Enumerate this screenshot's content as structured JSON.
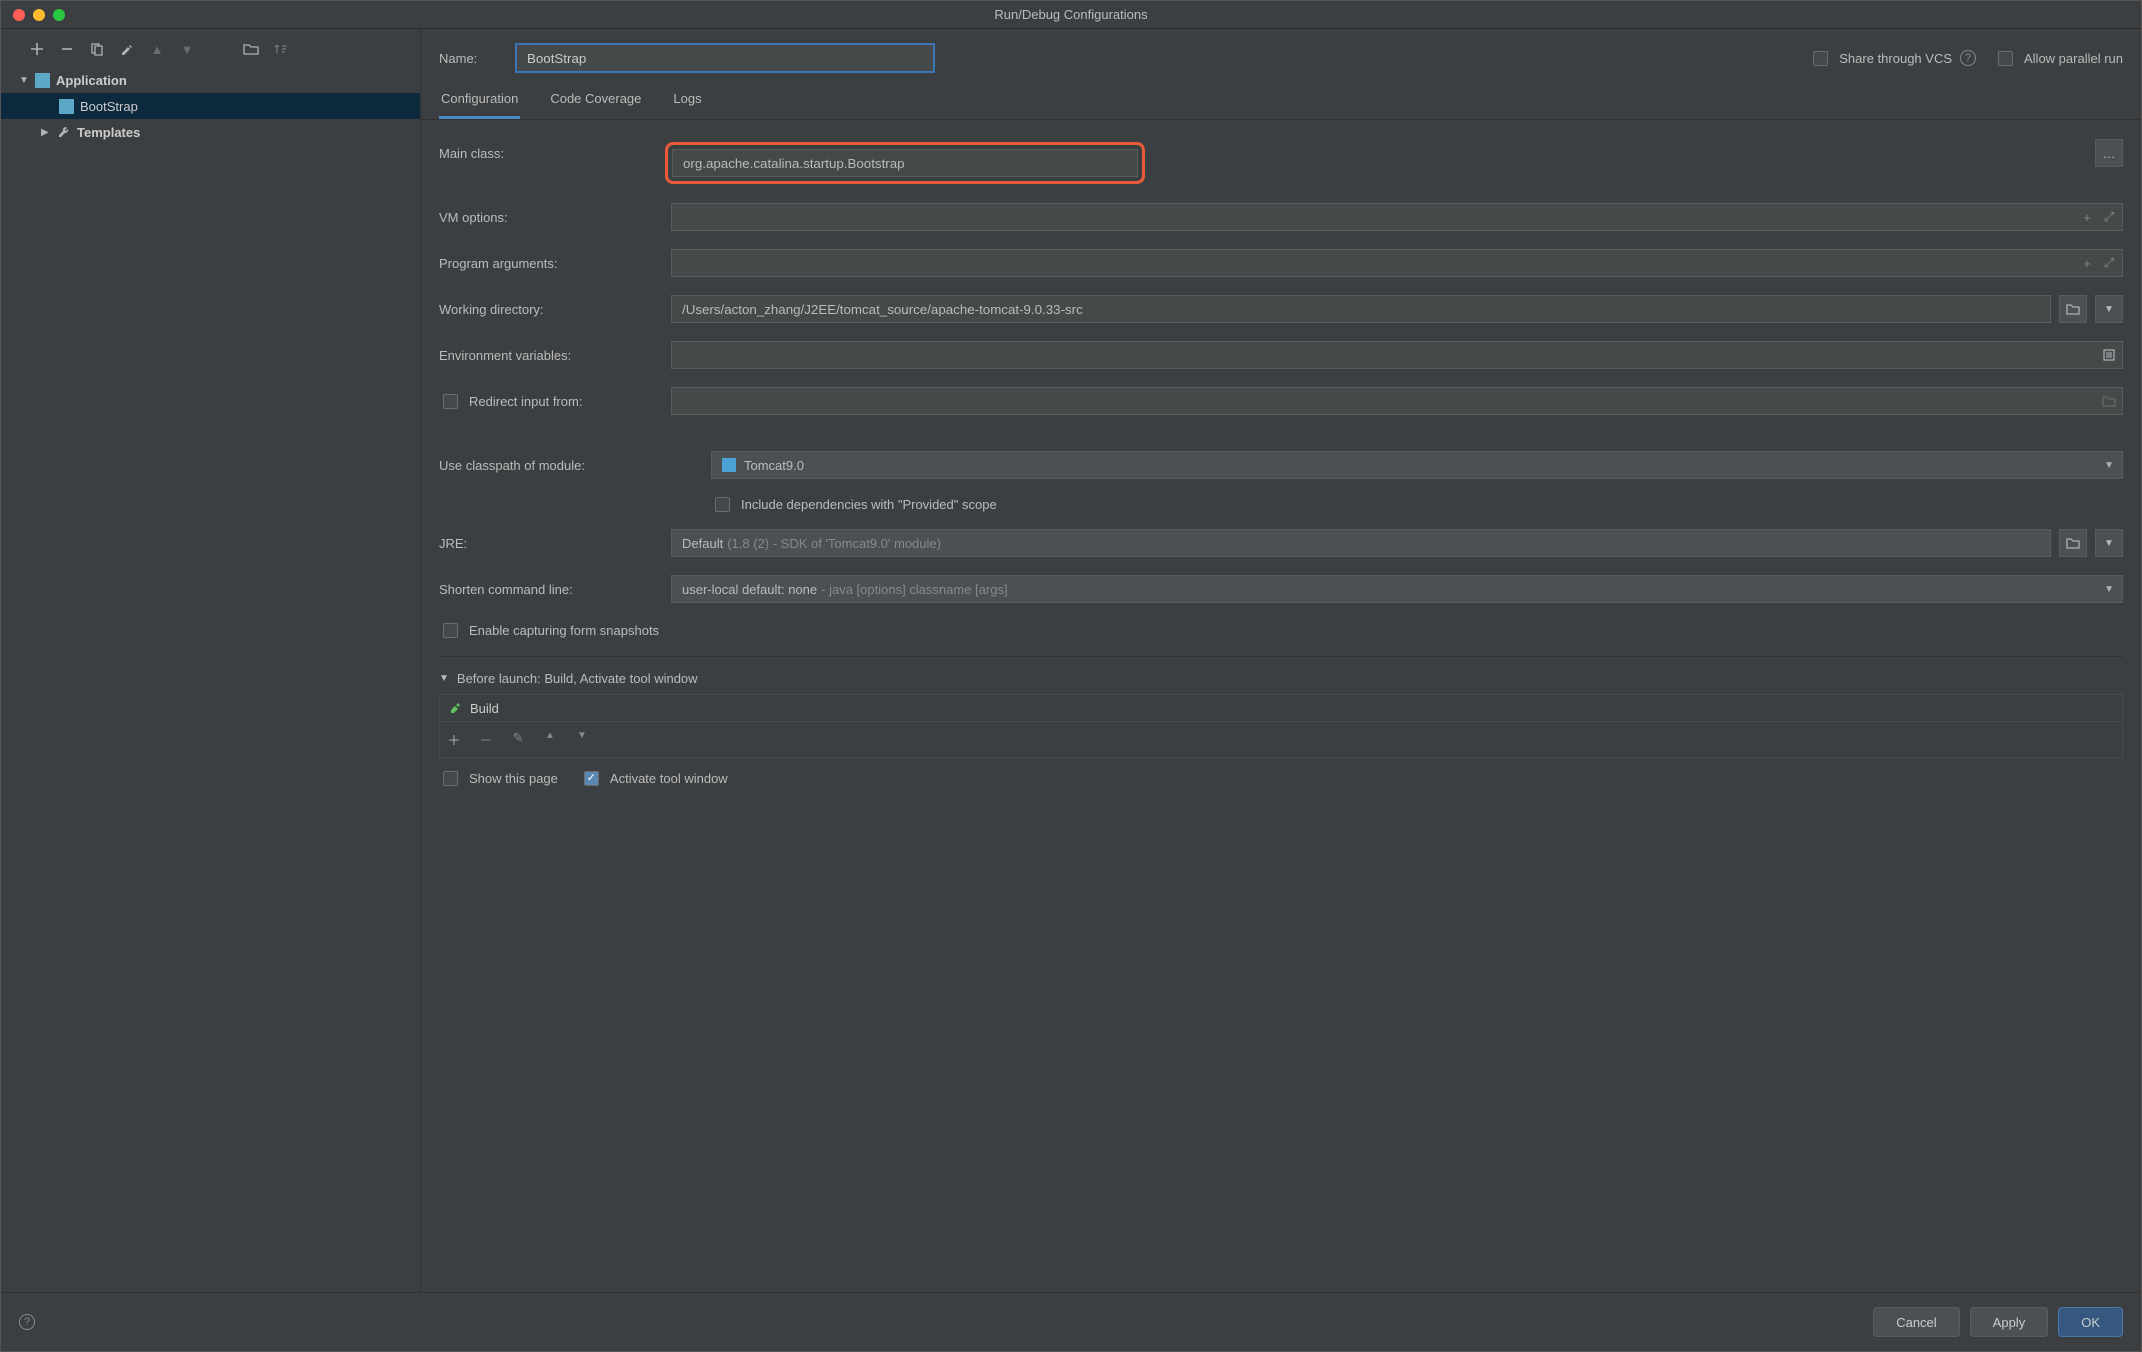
{
  "title": "Run/Debug Configurations",
  "sidebar": {
    "application": "Application",
    "bootstrap": "BootStrap",
    "templates": "Templates"
  },
  "header": {
    "name_label": "Name:",
    "name_value": "BootStrap",
    "share_label": "Share through VCS",
    "allow_parallel_label": "Allow parallel run"
  },
  "tabs": {
    "configuration": "Configuration",
    "coverage": "Code Coverage",
    "logs": "Logs"
  },
  "form": {
    "main_class_label": "Main class:",
    "main_class_value": "org.apache.catalina.startup.Bootstrap",
    "vm_options_label": "VM options:",
    "vm_options_value": "",
    "program_args_label": "Program arguments:",
    "program_args_value": "",
    "working_dir_label": "Working directory:",
    "working_dir_value": "/Users/acton_zhang/J2EE/tomcat_source/apache-tomcat-9.0.33-src",
    "env_vars_label": "Environment variables:",
    "env_vars_value": "",
    "redirect_label": "Redirect input from:",
    "redirect_value": "",
    "classpath_label": "Use classpath of module:",
    "classpath_value": "Tomcat9.0",
    "include_provided_label": "Include dependencies with \"Provided\" scope",
    "jre_label": "JRE:",
    "jre_value": "Default",
    "jre_hint": "(1.8 (2) - SDK of 'Tomcat9.0' module)",
    "shorten_label": "Shorten command line:",
    "shorten_value": "user-local default: none",
    "shorten_hint": "- java [options] classname [args]",
    "enable_capture_label": "Enable capturing form snapshots"
  },
  "before_launch": {
    "heading": "Before launch: Build, Activate tool window",
    "item": "Build",
    "show_page": "Show this page",
    "activate_window": "Activate tool window"
  },
  "footer": {
    "cancel": "Cancel",
    "apply": "Apply",
    "ok": "OK"
  }
}
